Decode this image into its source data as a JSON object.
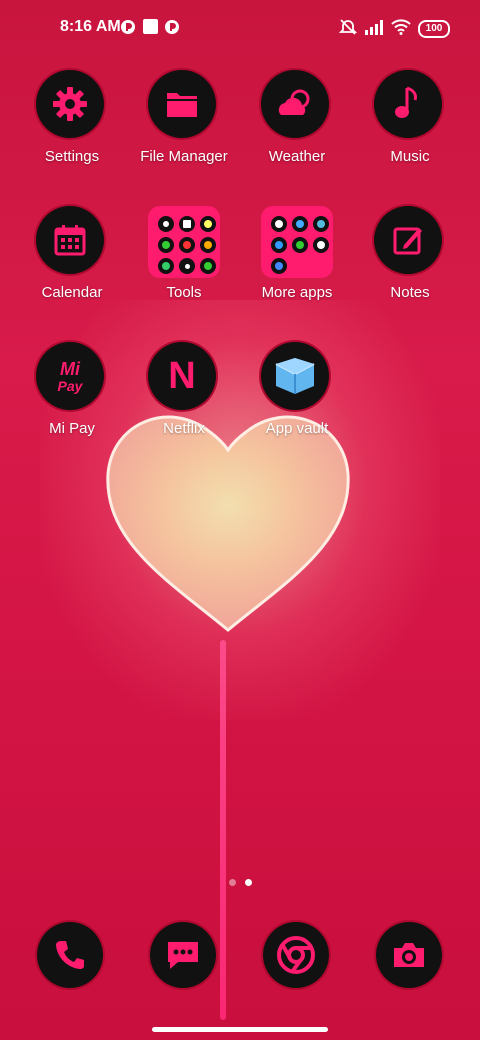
{
  "status_bar": {
    "time": "8:16 AM",
    "battery": "100",
    "icons": [
      "mute-icon",
      "signal-icon",
      "wifi-icon",
      "battery-icon"
    ]
  },
  "apps": [
    {
      "label": "Settings",
      "icon": "gear-icon"
    },
    {
      "label": "File Manager",
      "icon": "folder-icon"
    },
    {
      "label": "Weather",
      "icon": "weather-icon"
    },
    {
      "label": "Music",
      "icon": "music-note-icon"
    },
    {
      "label": "Calendar",
      "icon": "calendar-icon"
    },
    {
      "label": "Tools",
      "icon": "folder-tools"
    },
    {
      "label": "More apps",
      "icon": "folder-more-apps"
    },
    {
      "label": "Notes",
      "icon": "notes-icon"
    },
    {
      "label": "Mi Pay",
      "icon": "mi-pay-icon",
      "icon_text": "Mi Pay"
    },
    {
      "label": "Netflix",
      "icon": "netflix-icon",
      "icon_text": "N"
    },
    {
      "label": "App vault",
      "icon": "app-vault-icon"
    }
  ],
  "dock": [
    {
      "name": "phone",
      "icon": "phone-icon"
    },
    {
      "name": "messages",
      "icon": "message-icon"
    },
    {
      "name": "chrome",
      "icon": "chrome-icon"
    },
    {
      "name": "camera",
      "icon": "camera-icon"
    }
  ],
  "page_indicator": {
    "pages": 2,
    "current": 2
  },
  "colors": {
    "accent": "#ff1b6e",
    "icon_bg": "#111111",
    "wallpaper": "#d41545"
  }
}
